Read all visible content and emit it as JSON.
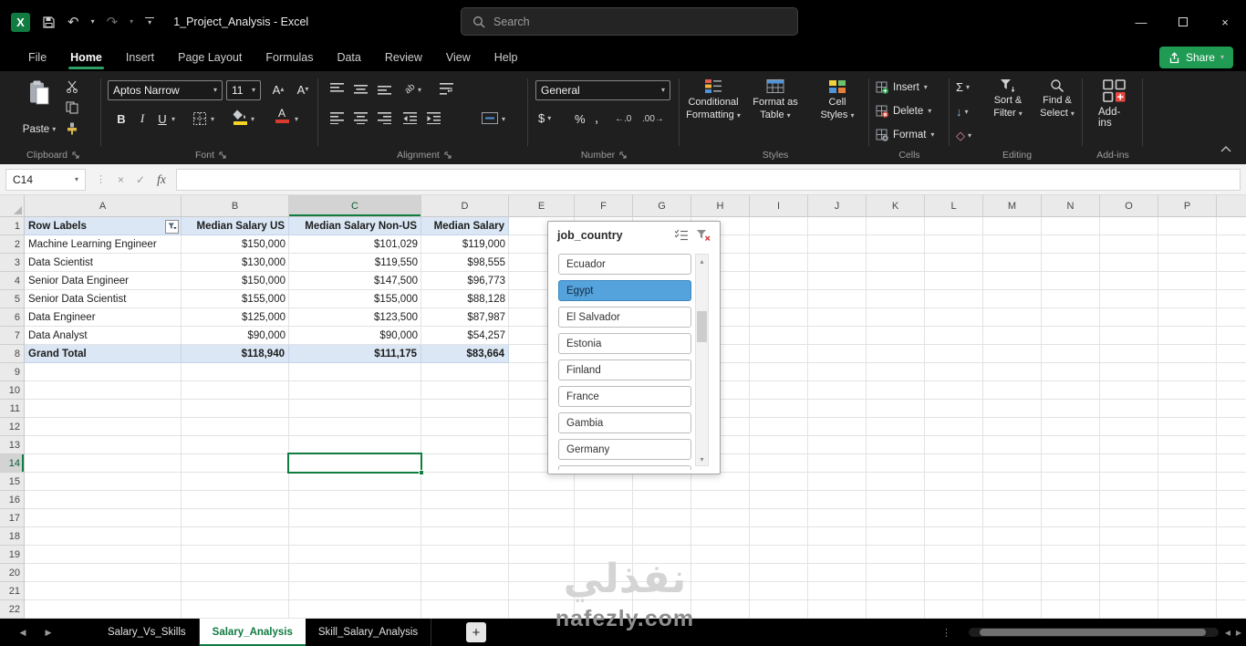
{
  "icons": {
    "excel_logo": "X",
    "undo": "↶",
    "redo": "↷",
    "minimize": "—",
    "close": "×",
    "cancel": "×",
    "confirm": "✓",
    "grip_dots": "⋮",
    "caret_down": "▾",
    "caret_up": "▴",
    "tab_prev": "◀",
    "tab_next": "▶",
    "scroll_left": "◀",
    "scroll_right": "▶",
    "add_sheet": "+",
    "tab_dots": "⋮",
    "autosum": "Σ",
    "fill": "↓",
    "clear": "◇",
    "increase_decimal": "←.0",
    "decrease_decimal": ".00→"
  },
  "title_bar": {
    "app_title": "1_Project_Analysis - Excel",
    "search_placeholder": "Search"
  },
  "menu": {
    "items": [
      "File",
      "Home",
      "Insert",
      "Page Layout",
      "Formulas",
      "Data",
      "Review",
      "View",
      "Help"
    ],
    "active_item": "Home",
    "share_label": "Share"
  },
  "ribbon": {
    "group_labels": [
      "Clipboard",
      "Font",
      "Alignment",
      "Number",
      "Styles",
      "Cells",
      "Editing",
      "Add-ins"
    ],
    "paste": "Paste",
    "font_name": "Aptos Narrow",
    "font_size": "11",
    "font_letter": "A",
    "bold": "B",
    "italic": "I",
    "underline": "U",
    "orientation": "ab",
    "number_format": "General",
    "currency": "$",
    "percent": "%",
    "comma": ",",
    "conditional_formatting": [
      "Conditional",
      "Formatting"
    ],
    "format_as_table": [
      "Format as",
      "Table"
    ],
    "cell_styles": [
      "Cell",
      "Styles"
    ],
    "insert": "Insert",
    "delete": "Delete",
    "format": "Format",
    "sort_filter": [
      "Sort &",
      "Filter"
    ],
    "find_select": [
      "Find &",
      "Select"
    ],
    "addins_button": "Add-ins"
  },
  "formula_bar": {
    "name_box": "C14",
    "fx": "fx",
    "formula": ""
  },
  "grid": {
    "columns": [
      "A",
      "B",
      "C",
      "D",
      "E",
      "F",
      "G",
      "H",
      "I",
      "J",
      "K",
      "L",
      "M",
      "N",
      "O",
      "P"
    ],
    "rows": [
      "1",
      "2",
      "3",
      "4",
      "5",
      "6",
      "7",
      "8",
      "9",
      "10",
      "11",
      "12",
      "13",
      "14",
      "15",
      "16",
      "17",
      "18",
      "19",
      "20",
      "21",
      "22"
    ],
    "selected_cell": "C14",
    "selected_column": "C",
    "selected_row": "14"
  },
  "pivot": {
    "headers": [
      "Row Labels",
      "Median Salary US",
      "Median Salary Non-US",
      "Median Salary"
    ],
    "rows": [
      [
        "Machine Learning Engineer",
        "$150,000",
        "$101,029",
        "$119,000"
      ],
      [
        "Data Scientist",
        "$130,000",
        "$119,550",
        "$98,555"
      ],
      [
        "Senior Data Engineer",
        "$150,000",
        "$147,500",
        "$96,773"
      ],
      [
        "Senior Data Scientist",
        "$155,000",
        "$155,000",
        "$88,128"
      ],
      [
        "Data Engineer",
        "$125,000",
        "$123,500",
        "$87,987"
      ],
      [
        "Data Analyst",
        "$90,000",
        "$90,000",
        "$54,257"
      ]
    ],
    "grand_total": [
      "Grand Total",
      "$118,940",
      "$111,175",
      "$83,664"
    ]
  },
  "slicer": {
    "title": "job_country",
    "items": [
      "Ecuador",
      "Egypt",
      "El Salvador",
      "Estonia",
      "Finland",
      "France",
      "Gambia",
      "Germany"
    ],
    "selected_item": "Egypt"
  },
  "sheet_tabs": {
    "tabs": [
      "Salary_Vs_Skills",
      "Salary_Analysis",
      "Skill_Salary_Analysis"
    ],
    "active_tab": "Salary_Analysis"
  },
  "watermark": {
    "text": "نفذلي",
    "site": "nafezly.com"
  }
}
